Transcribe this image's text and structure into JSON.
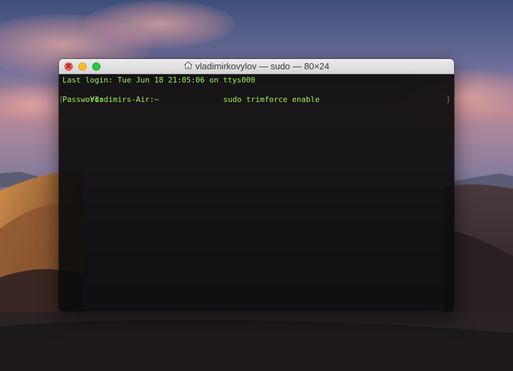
{
  "window": {
    "title": "vladimirkovylov — sudo — 80×24",
    "title_icon": "home-folder-icon"
  },
  "terminal": {
    "last_login": "Last login: Tue Jun 18 21:05:06 on ttys000",
    "prompt": "Vladimirs-Air:~",
    "command": "sudo trimforce enable",
    "password_prompt": "Password:"
  },
  "colors": {
    "terminal_text": "#9df24d",
    "terminal_bg": "#0c0c0c",
    "close": "#fc5f57",
    "minimize": "#fdbc2e",
    "maximize": "#28c840"
  }
}
